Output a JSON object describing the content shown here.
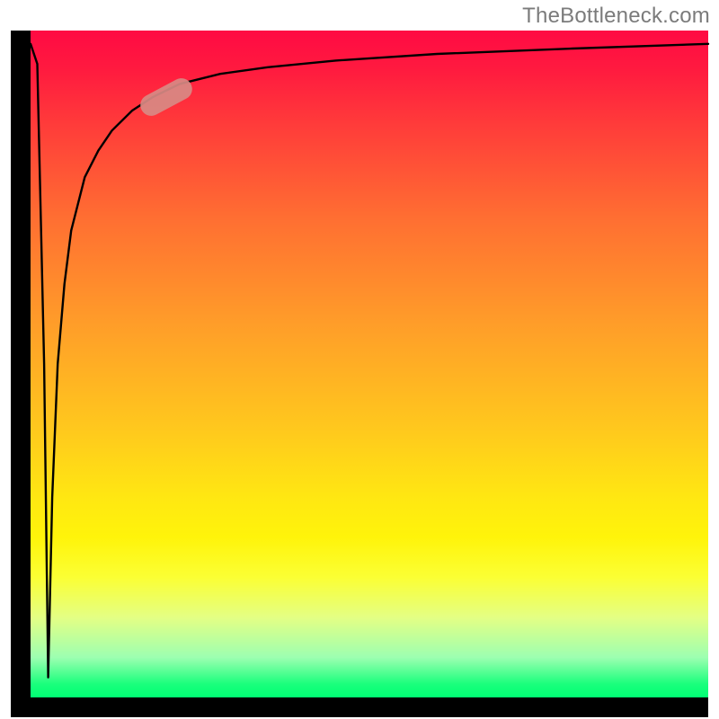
{
  "attribution": "TheBottleneck.com",
  "colors": {
    "gradient_top": "#ff0a43",
    "gradient_bottom": "#00ff74",
    "frame": "#000000",
    "curve": "#000000",
    "marker": "#d88a84",
    "attribution_text": "#7b7b7b"
  },
  "chart_data": {
    "type": "line",
    "title": "",
    "xlabel": "",
    "ylabel": "",
    "xlim": [
      0,
      100
    ],
    "ylim": [
      0,
      100
    ],
    "background": "vertical gradient red→orange→yellow→green (heatmap-style)",
    "series": [
      {
        "name": "bottleneck-curve",
        "x": [
          0,
          1,
          2,
          2.6,
          3.2,
          4,
          5,
          6,
          8,
          10,
          12,
          15,
          18,
          22,
          28,
          35,
          45,
          60,
          80,
          100
        ],
        "y": [
          98,
          95,
          50,
          3,
          30,
          50,
          62,
          70,
          78,
          82,
          85,
          88,
          90,
          92,
          93.5,
          94.5,
          95.5,
          96.5,
          97.3,
          98
        ],
        "note": "y is percentage of plot height from bottom; curve spikes from top-left down to near-bottom then recovers asymptotically toward top-right"
      }
    ],
    "marker": {
      "on_series": "bottleneck-curve",
      "x": 20,
      "y": 90,
      "shape": "pill",
      "angle_deg": -28
    }
  }
}
